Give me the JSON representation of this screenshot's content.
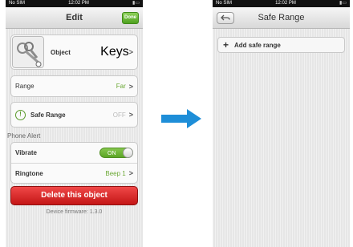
{
  "left_screen": {
    "status": {
      "carrier": "No SIM",
      "time": "12:02 PM"
    },
    "nav": {
      "title": "Edit",
      "done_label": "Done"
    },
    "object_row": {
      "label": "Object",
      "value": "Keys"
    },
    "range_row": {
      "label": "Range",
      "value": "Far"
    },
    "safe_range_row": {
      "label": "Safe Range",
      "value": "OFF"
    },
    "phone_alert": {
      "header": "Phone Alert",
      "vibrate": {
        "label": "Vibrate",
        "toggle": "ON"
      },
      "ringtone": {
        "label": "Ringtone",
        "value": "Beep 1"
      }
    },
    "delete_label": "Delete this object",
    "firmware": "Device firmware: 1.3.0"
  },
  "right_screen": {
    "status": {
      "carrier": "No SIM",
      "time": "12:02 PM"
    },
    "nav": {
      "title": "Safe Range"
    },
    "add_label": "Add safe range"
  },
  "colors": {
    "accent_green": "#6ba834",
    "delete_red": "#d92a2a",
    "arrow_blue": "#1e8ed8"
  },
  "icons": [
    "keys-thumbnail",
    "alert-icon",
    "chevron-right-icon",
    "back-icon",
    "plus-icon",
    "right-arrow-icon",
    "battery-icon"
  ]
}
